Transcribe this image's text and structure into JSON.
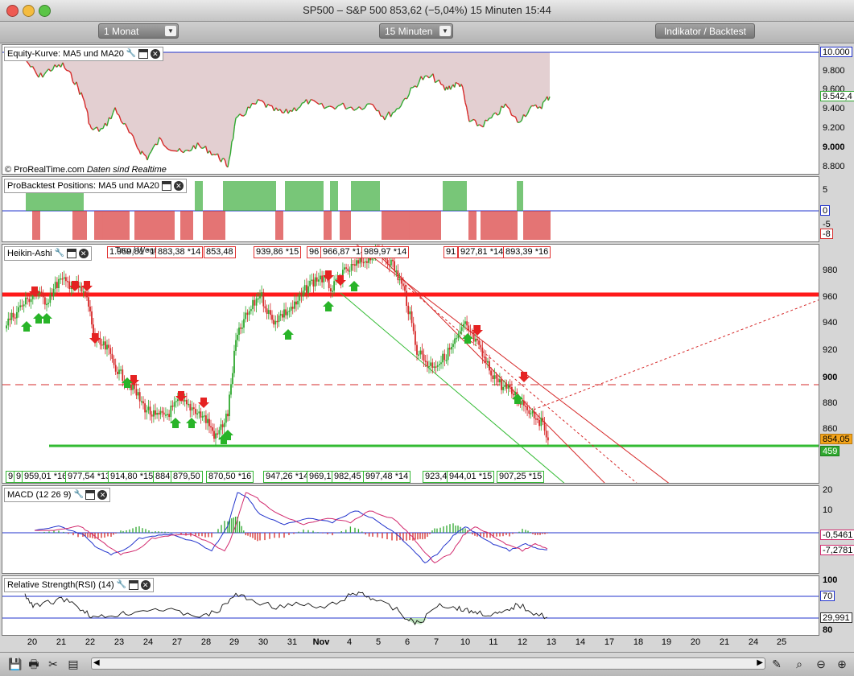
{
  "window": {
    "title": "SP500 – S&P 500    853,62 (−5,04%)    15 Minuten  15:44"
  },
  "toolbar": {
    "period_select": "1 Monat",
    "interval_select": "15 Minuten",
    "indicator_button": "Indikator / Backtest"
  },
  "panes": {
    "equity": {
      "title": "Equity-Kurve: MA5 und MA20",
      "credit": "© ProRealTime.com",
      "credit_note": "Daten sind Realtime",
      "axis": [
        "9.800",
        "9.600",
        "9.400",
        "9.200",
        "9.000",
        "8.800"
      ],
      "box_top": "10.000",
      "box_last": "9.542,4"
    },
    "positions": {
      "title": "ProBacktest Positions: MA5 und MA20",
      "axis": [
        "5",
        "-5"
      ],
      "box_zero": "0",
      "box_last": "-8"
    },
    "heikin": {
      "title": "Heikin-Ashi",
      "axis": [
        "980",
        "960",
        "940",
        "920",
        "900",
        "880",
        "860"
      ],
      "box_last": "854,05",
      "box_level": "459",
      "top_labels": [
        "1.959,81 *16",
        "883,38 *14",
        "853,48",
        "939,86 *15",
        "96",
        "966,87 *14",
        "989,97 *14",
        "91",
        "927,81 *14",
        "893,39 *16"
      ],
      "overlay_label": "Tarp / Wear",
      "bottom_labels": [
        "9",
        "9",
        "959,01 *16",
        "977,54 *13",
        "914,80 *15",
        "884",
        "879,50",
        "870,50 *16",
        "947,26 *14",
        "969,1",
        "982,45",
        "997,48 *14",
        "923,4",
        "944,01 *15",
        "907,25 *15"
      ]
    },
    "macd": {
      "title": "MACD (12 26 9)",
      "axis": [
        "20",
        "10"
      ],
      "box_a": "-0,5461",
      "box_b": "-7,2781"
    },
    "rsi": {
      "title": "Relative Strength(RSI) (14)",
      "axis": [
        "100",
        "80"
      ],
      "box_a": "70",
      "box_b": "29,991"
    }
  },
  "xaxis": [
    "20",
    "21",
    "22",
    "23",
    "24",
    "27",
    "28",
    "29",
    "30",
    "31",
    "Nov",
    "4",
    "5",
    "6",
    "7",
    "10",
    "11",
    "12",
    "13",
    "14",
    "17",
    "18",
    "19",
    "20",
    "21",
    "24",
    "25"
  ],
  "colors": {
    "up": "#2fa82f",
    "down": "#d62828",
    "equity_fill": "#e3cfd1",
    "macd_line": "#2233cc",
    "signal_line": "#d22a6e"
  }
}
